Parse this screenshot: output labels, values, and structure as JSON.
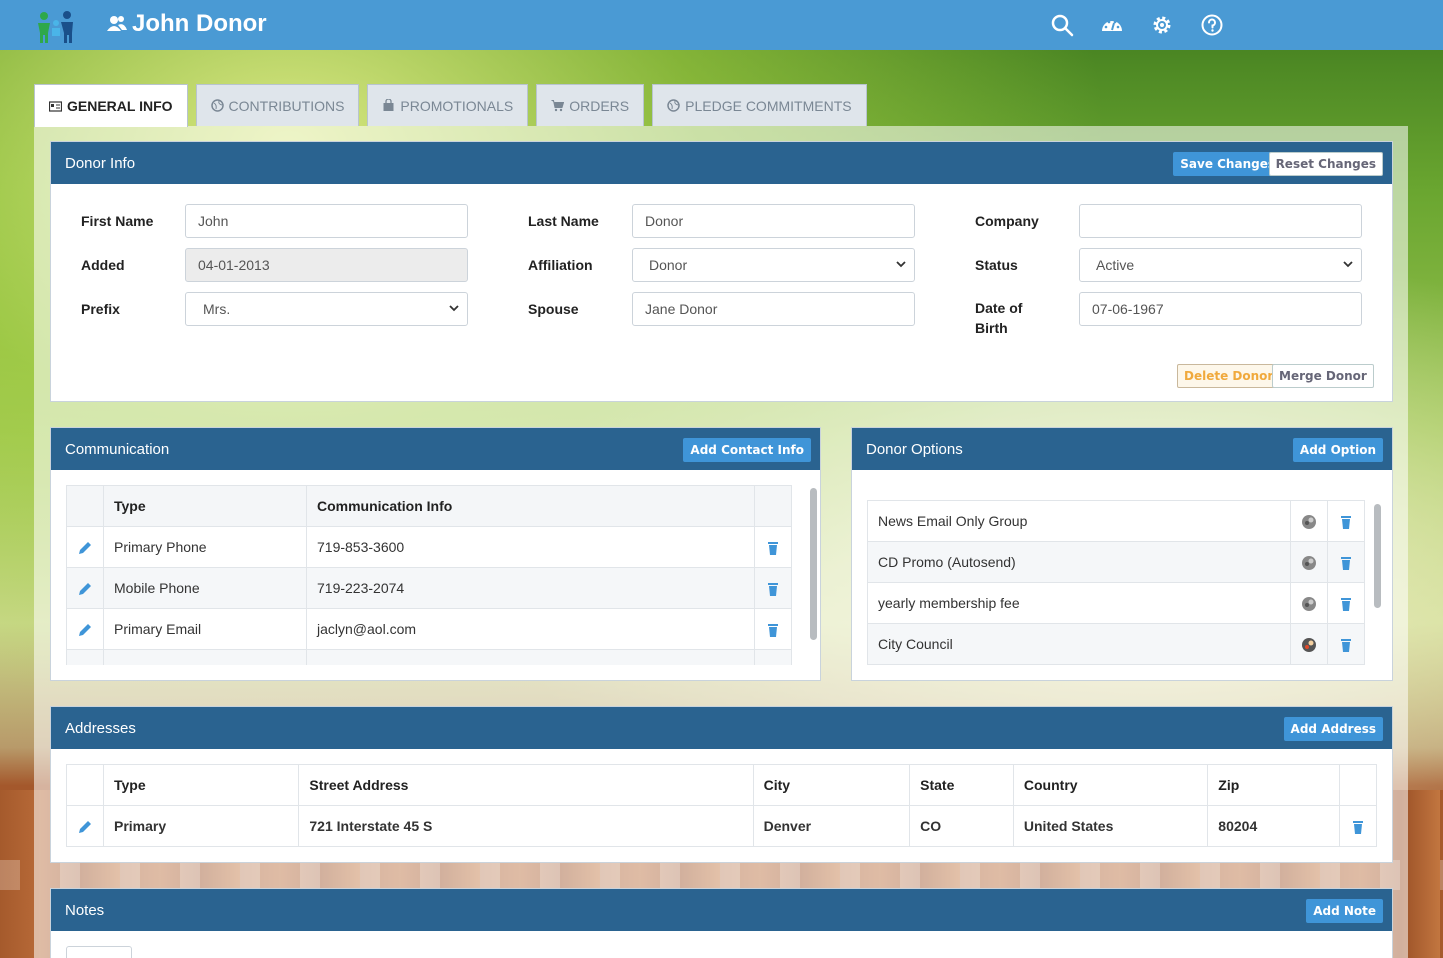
{
  "app": {
    "title": "John Donor"
  },
  "tabs": [
    {
      "label": "GENERAL INFO",
      "icon": "id-card-icon",
      "active": true
    },
    {
      "label": "CONTRIBUTIONS",
      "icon": "globe-icon",
      "active": false
    },
    {
      "label": "PROMOTIONALS",
      "icon": "bag-icon",
      "active": false
    },
    {
      "label": "ORDERS",
      "icon": "cart-icon",
      "active": false
    },
    {
      "label": "PLEDGE COMMITMENTS",
      "icon": "globe-icon",
      "active": false
    }
  ],
  "donor_info": {
    "title": "Donor Info",
    "save_label": "Save Changes",
    "reset_label": "Reset Changes",
    "first_name_label": "First Name",
    "first_name": "John",
    "last_name_label": "Last Name",
    "last_name": "Donor",
    "company_label": "Company",
    "company": "",
    "added_label": "Added",
    "added": "04-01-2013",
    "affiliation_label": "Affiliation",
    "affiliation": "Donor",
    "status_label": "Status",
    "status": "Active",
    "prefix_label": "Prefix",
    "prefix": "Mrs.",
    "spouse_label": "Spouse",
    "spouse": "Jane Donor",
    "dob_label": "Date of Birth",
    "dob": "07-06-1967",
    "delete_label": "Delete Donor",
    "merge_label": "Merge Donor"
  },
  "communication": {
    "title": "Communication",
    "add_label": "Add Contact Info",
    "columns": [
      "Type",
      "Communication Info"
    ],
    "rows": [
      {
        "type": "Primary Phone",
        "info": "719-853-3600"
      },
      {
        "type": "Mobile Phone",
        "info": "719-223-2074"
      },
      {
        "type": "Primary Email",
        "info": "jaclyn@aol.com"
      }
    ]
  },
  "donor_options": {
    "title": "Donor Options",
    "add_label": "Add Option",
    "items": [
      {
        "name": "News Email Only Group"
      },
      {
        "name": "CD Promo (Autosend)"
      },
      {
        "name": "yearly membership fee"
      },
      {
        "name": "City Council"
      }
    ]
  },
  "addresses": {
    "title": "Addresses",
    "add_label": "Add Address",
    "columns": [
      "Type",
      "Street Address",
      "City",
      "State",
      "Country",
      "Zip"
    ],
    "rows": [
      {
        "type": "Primary",
        "street": "721 Interstate 45 S",
        "city": "Denver",
        "state": "CO",
        "country": "United States",
        "zip": "80204"
      }
    ]
  },
  "notes": {
    "title": "Notes",
    "add_label": "Add Note"
  },
  "colors": {
    "topbar": "#4a9ad4",
    "panel_header": "#2a6390",
    "button_blue": "#3f95d8",
    "delete_warning": "#f0a93c"
  }
}
